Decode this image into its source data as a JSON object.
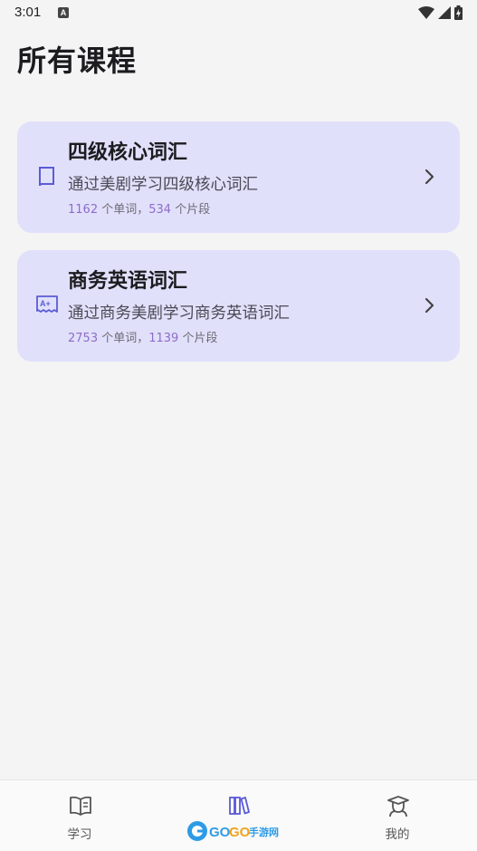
{
  "status_bar": {
    "time": "3:01",
    "notification_icon": "a-notification-icon",
    "icons": [
      "wifi-icon",
      "signal-icon",
      "battery-charging-icon"
    ]
  },
  "page": {
    "title": "所有课程"
  },
  "courses": [
    {
      "icon": "book-icon",
      "title": "四级核心词汇",
      "description": "通过美剧学习四级核心词汇",
      "words": "1162",
      "words_suffix": " 个单词，",
      "clips": "534",
      "clips_suffix": " 个片段"
    },
    {
      "icon": "grade-a-plus-icon",
      "title": "商务英语词汇",
      "description": "通过商务美剧学习商务英语词汇",
      "words": "2753",
      "words_suffix": " 个单词，",
      "clips": "1139",
      "clips_suffix": " 个片段"
    }
  ],
  "bottom_nav": {
    "items": [
      {
        "label": "学习",
        "icon": "open-book-icon"
      },
      {
        "label": "",
        "icon": "library-books-icon",
        "active": true
      },
      {
        "label": "我的",
        "icon": "graduate-icon"
      }
    ]
  },
  "watermark": {
    "brand": "GOGO手游网"
  },
  "colors": {
    "card_bg": "#e1e0fb",
    "accent": "#5b5bd6",
    "stat_number": "#8e6cc9",
    "page_bg": "#f4f4f4"
  }
}
